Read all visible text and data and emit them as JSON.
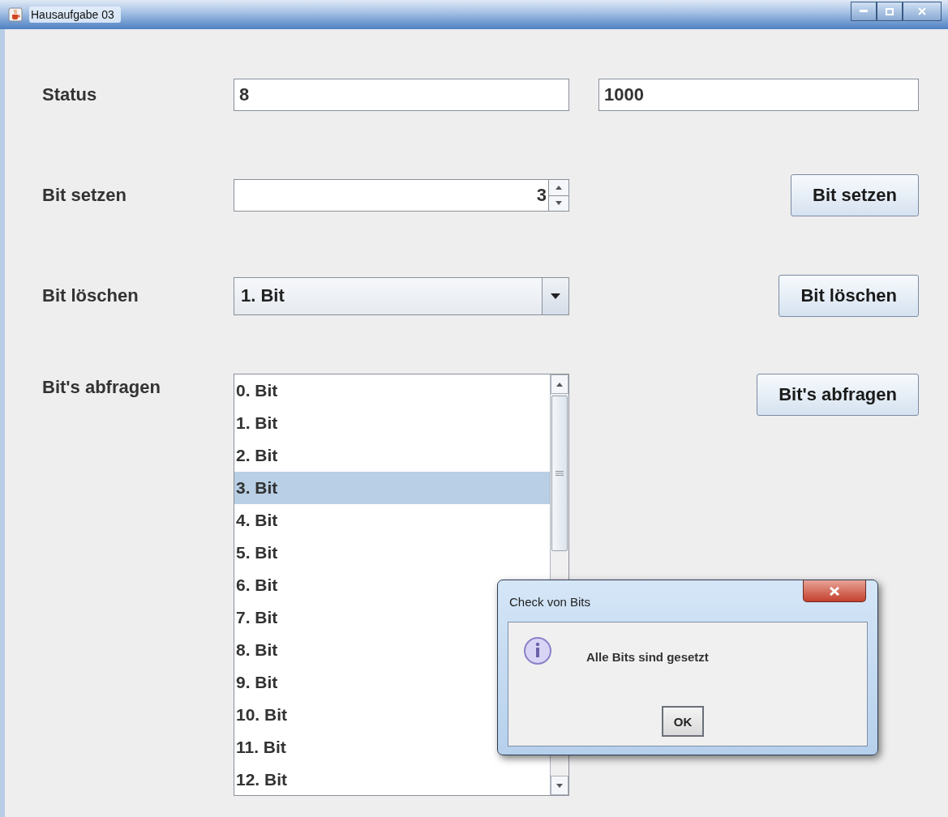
{
  "window": {
    "title": "Hausaufgabe 03"
  },
  "status": {
    "label": "Status",
    "decimal": "8",
    "binary": "1000"
  },
  "set_bit": {
    "label": "Bit setzen",
    "value": "3",
    "button": "Bit setzen"
  },
  "clear_bit": {
    "label": "Bit löschen",
    "value": "1. Bit",
    "button": "Bit löschen"
  },
  "query_bits": {
    "label": "Bit's abfragen",
    "button": "Bit's abfragen",
    "items": [
      {
        "label": "0. Bit",
        "selected": false
      },
      {
        "label": "1. Bit",
        "selected": false
      },
      {
        "label": "2. Bit",
        "selected": false
      },
      {
        "label": "3. Bit",
        "selected": true
      },
      {
        "label": "4. Bit",
        "selected": false
      },
      {
        "label": "5. Bit",
        "selected": false
      },
      {
        "label": "6. Bit",
        "selected": false
      },
      {
        "label": "7. Bit",
        "selected": false
      },
      {
        "label": "8. Bit",
        "selected": false
      },
      {
        "label": "9. Bit",
        "selected": false
      },
      {
        "label": "10. Bit",
        "selected": false
      },
      {
        "label": "11. Bit",
        "selected": false
      },
      {
        "label": "12. Bit",
        "selected": false
      }
    ]
  },
  "dialog": {
    "title": "Check von Bits",
    "message": "Alle Bits sind gesetzt",
    "button": "OK"
  }
}
